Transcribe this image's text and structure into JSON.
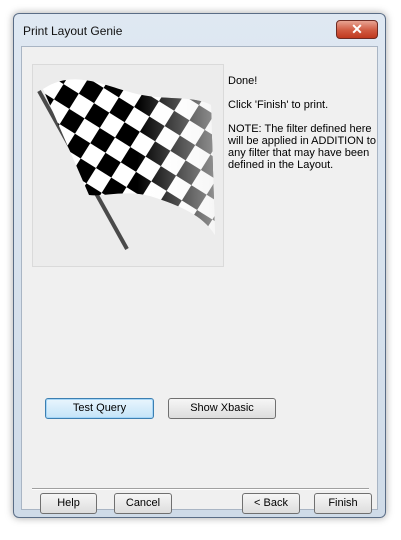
{
  "window": {
    "title": "Print Layout Genie",
    "close_glyph": "✕"
  },
  "image": {
    "name": "checkered-flag-icon"
  },
  "message": {
    "line1": "Done!",
    "line2": "Click 'Finish' to print.",
    "line3": "NOTE: The filter defined here will be applied in ADDITION to any filter that may have been defined in the Layout."
  },
  "buttons": {
    "test_query": "Test Query",
    "show_xbasic": "Show Xbasic",
    "help": "Help",
    "cancel": "Cancel",
    "back": "< Back",
    "finish": "Finish"
  }
}
